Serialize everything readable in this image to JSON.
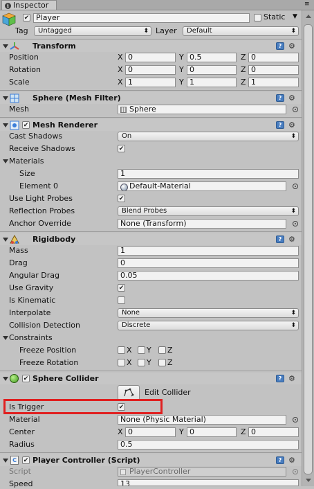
{
  "tab": {
    "title": "Inspector"
  },
  "object": {
    "name": "Player",
    "static_label": "Static",
    "tag_label": "Tag",
    "tag_value": "Untagged",
    "layer_label": "Layer",
    "layer_value": "Default",
    "active": true,
    "static": false
  },
  "transform": {
    "title": "Transform",
    "position": {
      "label": "Position",
      "x": "0",
      "y": "0.5",
      "z": "0"
    },
    "rotation": {
      "label": "Rotation",
      "x": "0",
      "y": "0",
      "z": "0"
    },
    "scale": {
      "label": "Scale",
      "x": "1",
      "y": "1",
      "z": "1"
    },
    "axis_x": "X",
    "axis_y": "Y",
    "axis_z": "Z"
  },
  "mesh_filter": {
    "title": "Sphere (Mesh Filter)",
    "mesh_label": "Mesh",
    "mesh_value": "Sphere"
  },
  "mesh_renderer": {
    "title": "Mesh Renderer",
    "cast_shadows_label": "Cast Shadows",
    "cast_shadows_value": "On",
    "receive_shadows_label": "Receive Shadows",
    "receive_shadows": true,
    "materials_label": "Materials",
    "size_label": "Size",
    "size_value": "1",
    "element0_label": "Element 0",
    "element0_value": "Default-Material",
    "light_probes_label": "Use Light Probes",
    "light_probes": true,
    "reflection_probes_label": "Reflection Probes",
    "reflection_probes_value": "Blend Probes",
    "anchor_override_label": "Anchor Override",
    "anchor_override_value": "None (Transform)"
  },
  "rigidbody": {
    "title": "Rigidbody",
    "mass_label": "Mass",
    "mass_value": "1",
    "drag_label": "Drag",
    "drag_value": "0",
    "angular_drag_label": "Angular Drag",
    "angular_drag_value": "0.05",
    "use_gravity_label": "Use Gravity",
    "use_gravity": true,
    "is_kinematic_label": "Is Kinematic",
    "is_kinematic": false,
    "interpolate_label": "Interpolate",
    "interpolate_value": "None",
    "collision_label": "Collision Detection",
    "collision_value": "Discrete",
    "constraints_label": "Constraints",
    "freeze_position_label": "Freeze Position",
    "freeze_rotation_label": "Freeze Rotation",
    "axis_x": "X",
    "axis_y": "Y",
    "axis_z": "Z"
  },
  "sphere_collider": {
    "title": "Sphere Collider",
    "edit_collider_label": "Edit Collider",
    "is_trigger_label": "Is Trigger",
    "is_trigger": true,
    "material_label": "Material",
    "material_value": "None (Physic Material)",
    "center_label": "Center",
    "center_x": "0",
    "center_y": "0",
    "center_z": "0",
    "radius_label": "Radius",
    "radius_value": "0.5",
    "axis_x": "X",
    "axis_y": "Y",
    "axis_z": "Z"
  },
  "player_controller": {
    "title": "Player Controller (Script)",
    "script_label": "Script",
    "script_value": "PlayerController",
    "speed_label": "Speed",
    "speed_value": "13"
  },
  "colors": {
    "highlight": "#e02020",
    "help_icon": "#4a7ec0",
    "panel": "#c2c2c2"
  }
}
